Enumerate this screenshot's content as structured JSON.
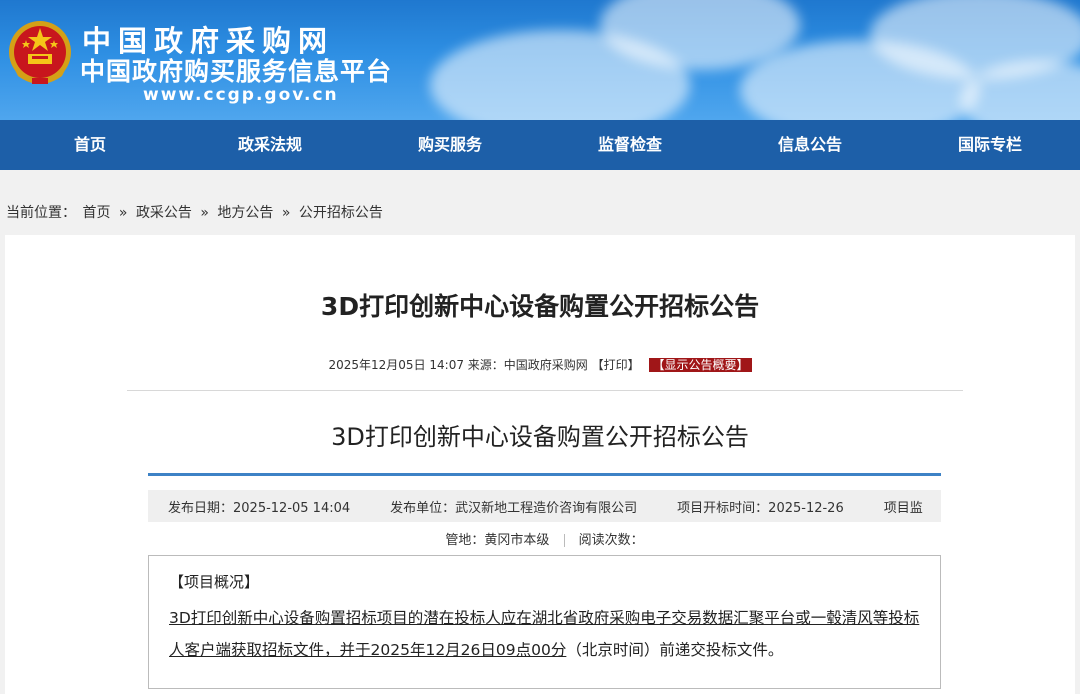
{
  "header": {
    "title": "中国政府采购网",
    "subtitle": "中国政府购买服务信息平台",
    "url": "www.ccgp.gov.cn",
    "emblem_icon": "national-emblem-icon"
  },
  "nav": {
    "items": [
      "首页",
      "政采法规",
      "购买服务",
      "监督检查",
      "信息公告",
      "国际专栏"
    ]
  },
  "breadcrumb": {
    "prefix": "当前位置：",
    "items": [
      "首页",
      "政采公告",
      "地方公告",
      "公开招标公告"
    ],
    "separator": "»"
  },
  "article": {
    "title": "3D打印创新中心设备购置公开招标公告",
    "meta": {
      "datetime": "2025年12月05日 14:07",
      "source": "来源：中国政府采购网",
      "print": "【打印】",
      "show_summary": "【显示公告概要】"
    },
    "subtitle": "3D打印创新中心设备购置公开招标公告",
    "info": {
      "publish_date": "发布日期：2025-12-05 14:04",
      "publisher": "发布单位：武汉新地工程造价咨询有限公司",
      "bid_open": "项目开标时间：2025-12-26",
      "supervisor": "项目监",
      "jurisdiction": "管地：黄冈市本级",
      "reads": "阅读次数："
    },
    "overview": {
      "heading": "【项目概况】",
      "text_part1": "3D打印创新中心设备购置招标项目的潜在投标人应在湖北省政府采购电子交易数据汇聚平台或一毂清风等投标人客户端获取招标文件，并于",
      "deadline": "2025年12月26日09点00分",
      "text_part2": "（北京时间）前递交投标文件。"
    }
  },
  "colors": {
    "nav_bg": "#1d5fa8",
    "banner_blue": "#2e8fe3",
    "accent_red": "#a01618",
    "divider_blue": "#3d82c6"
  }
}
